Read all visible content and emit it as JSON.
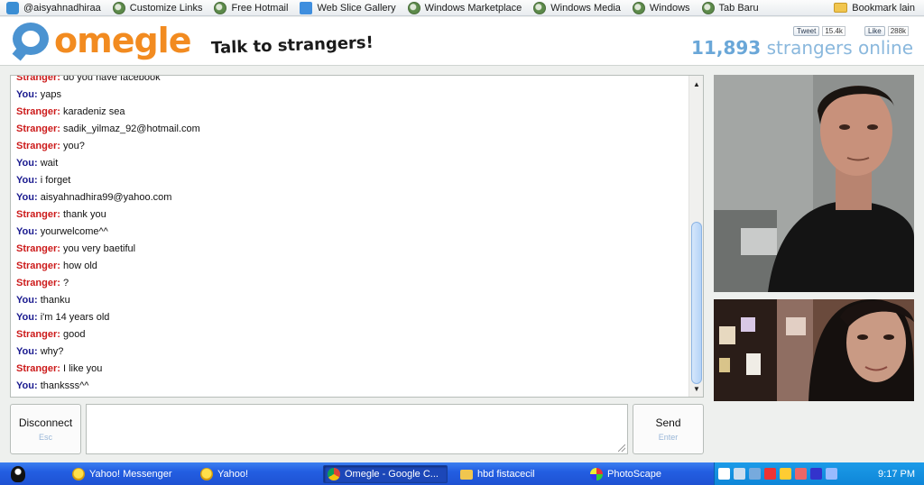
{
  "bookmarks": {
    "items": [
      {
        "label": "@aisyahnadhiraa",
        "icon": "twitter-icon"
      },
      {
        "label": "Customize Links",
        "icon": "ie-icon"
      },
      {
        "label": "Free Hotmail",
        "icon": "ie-icon"
      },
      {
        "label": "Web Slice Gallery",
        "icon": "web-slice-icon"
      },
      {
        "label": "Windows Marketplace",
        "icon": "ie-icon"
      },
      {
        "label": "Windows Media",
        "icon": "ie-icon"
      },
      {
        "label": "Windows",
        "icon": "ie-icon"
      },
      {
        "label": "Tab Baru",
        "icon": "ie-icon"
      }
    ],
    "other": "Bookmark lain"
  },
  "header": {
    "logo_text": "omegle",
    "tagline": "Talk to strangers!",
    "tweet_label": "Tweet",
    "tweet_count": "15.4k",
    "like_label": "Like",
    "like_count": "288k",
    "online_count": "11,893",
    "online_label": "strangers online"
  },
  "chat": {
    "lines": [
      {
        "who": "Stranger",
        "role": "stranger",
        "text": "do you have facebook"
      },
      {
        "who": "You",
        "role": "you",
        "text": "yaps"
      },
      {
        "who": "Stranger",
        "role": "stranger",
        "text": "karadeniz sea"
      },
      {
        "who": "Stranger",
        "role": "stranger",
        "text": "sadik_yilmaz_92@hotmail.com"
      },
      {
        "who": "Stranger",
        "role": "stranger",
        "text": "you?"
      },
      {
        "who": "You",
        "role": "you",
        "text": "wait"
      },
      {
        "who": "You",
        "role": "you",
        "text": "i forget"
      },
      {
        "who": "You",
        "role": "you",
        "text": "aisyahnadhira99@yahoo.com"
      },
      {
        "who": "Stranger",
        "role": "stranger",
        "text": "thank you"
      },
      {
        "who": "You",
        "role": "you",
        "text": "yourwelcome^^"
      },
      {
        "who": "Stranger",
        "role": "stranger",
        "text": "you very baetiful"
      },
      {
        "who": "Stranger",
        "role": "stranger",
        "text": "how old"
      },
      {
        "who": "Stranger",
        "role": "stranger",
        "text": "?"
      },
      {
        "who": "You",
        "role": "you",
        "text": "thanku"
      },
      {
        "who": "You",
        "role": "you",
        "text": "i'm 14 years old"
      },
      {
        "who": "Stranger",
        "role": "stranger",
        "text": "good"
      },
      {
        "who": "You",
        "role": "you",
        "text": "why?"
      },
      {
        "who": "Stranger",
        "role": "stranger",
        "text": "I like you"
      },
      {
        "who": "You",
        "role": "you",
        "text": "thanksss^^"
      }
    ]
  },
  "controls": {
    "disconnect_label": "Disconnect",
    "disconnect_hint": "Esc",
    "message_value": "",
    "send_label": "Send",
    "send_hint": "Enter"
  },
  "taskbar": {
    "tasks": [
      {
        "label": "Yahoo! Messenger",
        "icon": "yahoo-icon",
        "active": false
      },
      {
        "label": "Yahoo!",
        "icon": "yahoo-icon",
        "active": false
      },
      {
        "label": "Omegle - Google C...",
        "icon": "chrome-icon",
        "active": true
      },
      {
        "label": "hbd fistacecil",
        "icon": "folder-icon",
        "active": false
      },
      {
        "label": "PhotoScape",
        "icon": "photoscape-icon",
        "active": false
      }
    ],
    "clock": "9:17 PM"
  }
}
